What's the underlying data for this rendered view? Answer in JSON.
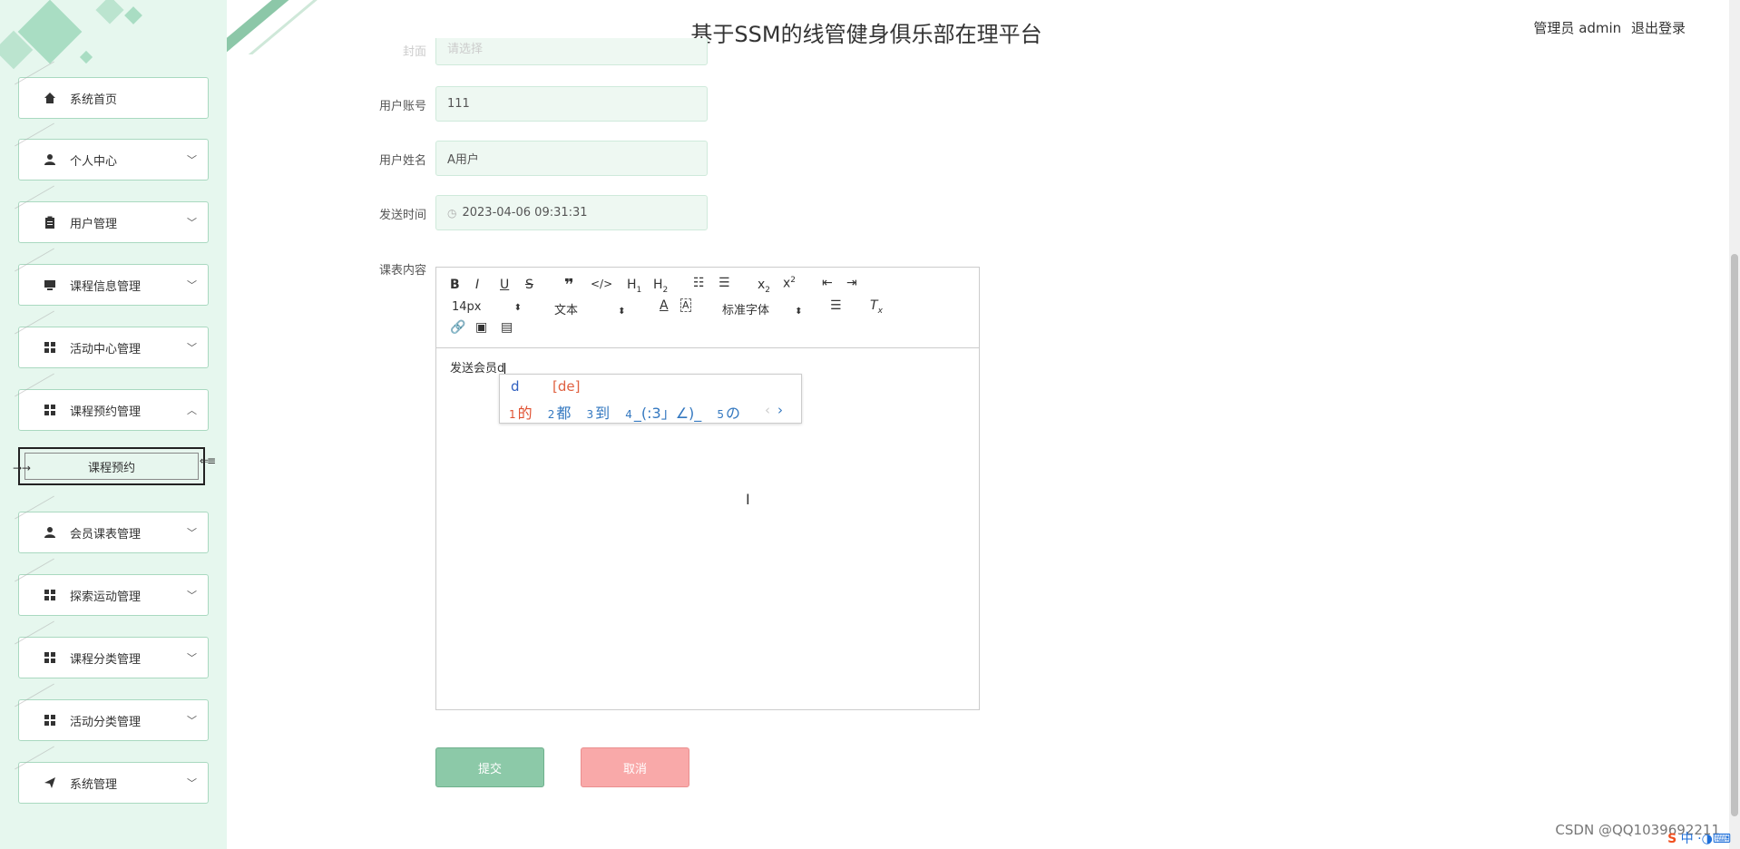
{
  "header": {
    "title": "基于SSM的线管健身俱乐部在理平台",
    "user_role": "管理员 admin",
    "logout": "退出登录"
  },
  "sidebar": {
    "items": [
      {
        "label": "系统首页",
        "icon": "home-icon",
        "expandable": false
      },
      {
        "label": "个人中心",
        "icon": "person-icon",
        "expandable": true
      },
      {
        "label": "用户管理",
        "icon": "clipboard-icon",
        "expandable": true
      },
      {
        "label": "课程信息管理",
        "icon": "screen-icon",
        "expandable": true
      },
      {
        "label": "活动中心管理",
        "icon": "grid-icon",
        "expandable": true
      },
      {
        "label": "课程预约管理",
        "icon": "grid-icon",
        "expandable": true,
        "expanded": true
      },
      {
        "label": "会员课表管理",
        "icon": "person-icon",
        "expandable": true
      },
      {
        "label": "探索运动管理",
        "icon": "grid-icon",
        "expandable": true
      },
      {
        "label": "课程分类管理",
        "icon": "grid-icon",
        "expandable": true
      },
      {
        "label": "活动分类管理",
        "icon": "grid-icon",
        "expandable": true
      },
      {
        "label": "系统管理",
        "icon": "send-icon",
        "expandable": true
      }
    ],
    "sub_item": "课程预约"
  },
  "form": {
    "partial_label": "封面",
    "partial_value": "请选择",
    "account_label": "用户账号",
    "account_value": "111",
    "name_label": "用户姓名",
    "name_value": "A用户",
    "time_label": "发送时间",
    "time_value": "2023-04-06 09:31:31",
    "content_label": "课表内容"
  },
  "editor": {
    "font_size": "14px",
    "text_type": "文本",
    "font_family": "标准字体",
    "content": "发送会员d"
  },
  "ime": {
    "input": "d",
    "pinyin": "[de]",
    "candidates": [
      {
        "num": "1",
        "text": "的"
      },
      {
        "num": "2",
        "text": "都"
      },
      {
        "num": "3",
        "text": "到"
      },
      {
        "num": "4",
        "text": "_(:3」∠)_"
      },
      {
        "num": "5",
        "text": "の"
      }
    ]
  },
  "buttons": {
    "submit": "提交",
    "cancel": "取消"
  },
  "watermark": "CSDN @QQ1039692211",
  "tray": {
    "ime_mode": "中"
  },
  "colors": {
    "sidebar_bg": "#e6f7ee",
    "accent_green": "#8cc9a8",
    "cancel_red": "#f9a9a9"
  }
}
